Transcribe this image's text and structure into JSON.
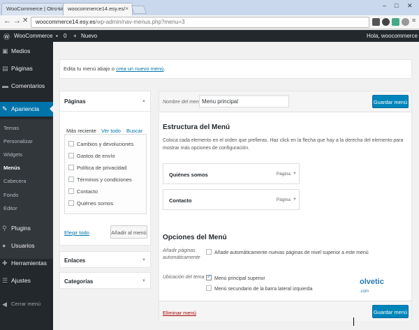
{
  "browser": {
    "tabs": [
      {
        "title": "WooCommerce | Otro siti"
      },
      {
        "title": "woocommerce14.esy.es/"
      }
    ],
    "url_host": "woocommerce14.esy.es",
    "url_path": "/wp-admin/nav-menus.php?menu=3"
  },
  "adminbar": {
    "site": "WooCommerce",
    "comments": "0",
    "new": "Nuevo",
    "greeting": "Hola, woocommerce"
  },
  "sidebar": {
    "items": [
      {
        "label": "Medios",
        "icon": "media-icon"
      },
      {
        "label": "Páginas",
        "icon": "pages-icon"
      },
      {
        "label": "Comentarios",
        "icon": "comments-icon"
      },
      {
        "label": "Apariencia",
        "icon": "appearance-icon"
      },
      {
        "label": "Plugins",
        "icon": "plugins-icon"
      },
      {
        "label": "Usuarios",
        "icon": "users-icon"
      },
      {
        "label": "Herramientas",
        "icon": "tools-icon"
      },
      {
        "label": "Ajustes",
        "icon": "settings-icon"
      },
      {
        "label": "Cerrar menú",
        "icon": "collapse-icon"
      }
    ],
    "submenu": [
      "Temas",
      "Personalizar",
      "Widgets",
      "Menús",
      "Cabecera",
      "Fondo",
      "Editor"
    ]
  },
  "notice": {
    "text": "Edita tu menú abajo o ",
    "link": "crea un nuevo menú",
    "end": "."
  },
  "pages_box": {
    "title": "Páginas",
    "tabs": [
      "Más reciente",
      "Ver todo",
      "Buscar"
    ],
    "items": [
      "Cambios y devoluciones",
      "Gastos de envío",
      "Política de privacidad",
      "Términos y condiciones",
      "Contacto",
      "Quiénes somos"
    ],
    "select_all": "Elegir todo",
    "add_button": "Añadir al menú"
  },
  "closed_boxes": [
    "Enlaces",
    "Categorías"
  ],
  "menu": {
    "name_label": "Nombre del menú",
    "name_value": "Menu principal",
    "save": "Guardar menú",
    "structure_title": "Estructura del Menú",
    "structure_desc": "Coloca cada elemento en el orden que prefieras. Haz click en la flecha que hay a la derecha del elemento para mostrar más opciones de configuración.",
    "items": [
      {
        "title": "Quiénes somos",
        "type": "Página"
      },
      {
        "title": "Contacto",
        "type": "Página"
      }
    ],
    "options_title": "Opciones del Menú",
    "auto_add_label": "Añadir páginas automáticamente",
    "auto_add_option": "Añade automáticamente nuevas páginas de nivel superior a este menú",
    "location_label": "Ubicación del tema",
    "locations": [
      {
        "label": "Menú principal superior",
        "checked": true
      },
      {
        "label": "Menú secundario de la barra lateral izquierda",
        "checked": false
      }
    ],
    "delete": "Eliminar menú"
  },
  "watermark": {
    "brand": "olvetic",
    "sub": ".com"
  }
}
